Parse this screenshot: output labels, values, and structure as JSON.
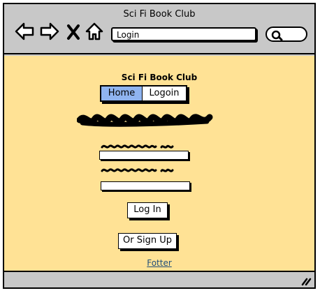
{
  "window": {
    "title": "Sci Fi Book Club"
  },
  "toolbar": {
    "icons": [
      "back-arrow-icon",
      "forward-arrow-icon",
      "close-x-icon",
      "home-icon"
    ],
    "url_value": "Login",
    "search_icon": "search-icon"
  },
  "page": {
    "app_title": "Sci Fi Book Club",
    "tabs": [
      {
        "label": "Home",
        "selected": true
      },
      {
        "label": "Logoin",
        "selected": false
      }
    ],
    "login_button": "Log In",
    "signup_button": "Or Sign Up",
    "footer_link": "Fotter"
  },
  "colors": {
    "content_background": "#ffe295",
    "chrome_background": "#c8c8c8",
    "tab_selected": "#8fb4f0",
    "link": "#1f4e79"
  }
}
